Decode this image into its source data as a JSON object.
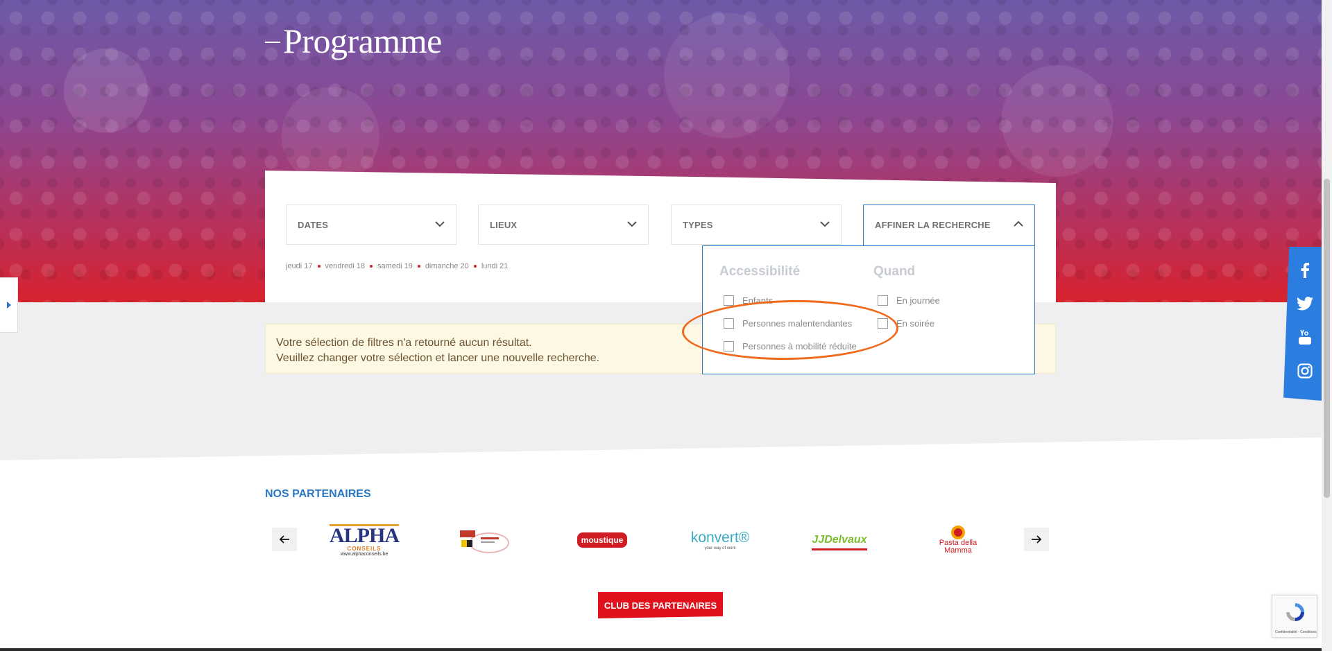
{
  "hero": {
    "title": "Programme"
  },
  "filters": {
    "dates_label": "DATES",
    "lieux_label": "LIEUX",
    "types_label": "TYPES",
    "affiner_label": "AFFINER LA RECHERCHE"
  },
  "days": [
    "jeudi 17",
    "vendredi 18",
    "samedi 19",
    "dimanche 20",
    "lundi 21"
  ],
  "message": {
    "line1": "Votre sélection de filtres n'a retourné aucun résultat.",
    "line2": "Veuillez changer votre sélection et lancer une nouvelle recherche."
  },
  "refine": {
    "accessibility_title": "Accessibilité",
    "accessibility_options": [
      "Enfants",
      "Personnes malentendantes",
      "Personnes à mobilité réduite"
    ],
    "when_title": "Quand",
    "when_options": [
      "En journée",
      "En soirée"
    ]
  },
  "partners": {
    "title": "NOS PARTENAIRES",
    "logos": {
      "alpha_big": "ALPHA",
      "alpha_small": "CONSEILS",
      "alpha_url": "www.alphaconseils.be",
      "moustique": "moustique",
      "konvert": "konvert®",
      "konvert_tag": "your way of work",
      "jj": "JJDelvaux",
      "pasta": "Pasta della Mamma"
    },
    "club_button": "CLUB DES PARTENAIRES"
  },
  "recaptcha": {
    "text": "Confidentialité - Conditions"
  },
  "colors": {
    "accent_blue": "#2b78c5",
    "brand_red": "#e0101c",
    "annotation_orange": "#ef6a1c"
  }
}
